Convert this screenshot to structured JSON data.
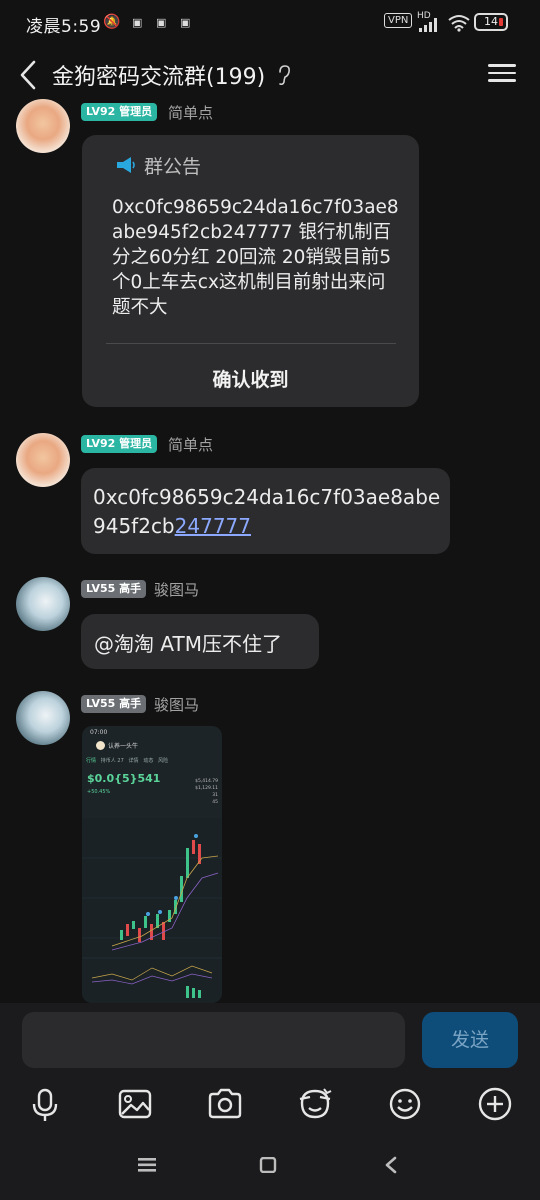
{
  "status_bar": {
    "time": "凌晨5:59",
    "vpn": "VPN",
    "hd": "HD",
    "battery": "14"
  },
  "header": {
    "title": "金狗密码交流群(199)"
  },
  "messages": [
    {
      "badge": "LV92 管理员",
      "nickname": "简单点",
      "notice_title": "群公告",
      "notice_body": "0xc0fc98659c24da16c7f03ae8abe945f2cb247777 银行机制百分之60分红 20回流 20销毁目前5个0上车去cx这机制目前射出来问题不大",
      "confirm_label": "确认收到"
    },
    {
      "badge": "LV92 管理员",
      "nickname": "简单点",
      "text_prefix": "0xc0fc98659c24da16c7f03ae8abe945f2cb",
      "text_link": "247777"
    },
    {
      "badge": "LV55 高手",
      "nickname": "骏图马",
      "text": "@淘淘 ATM压不住了"
    },
    {
      "badge": "LV55 高手",
      "nickname": "骏图马",
      "image": {
        "time": "07:00",
        "title": "认养一头牛",
        "tabs": [
          "行情",
          "持币人 27",
          "详情",
          "动态",
          "风险"
        ],
        "price": "$0.0{5}541",
        "change": "+50.45%",
        "stats": [
          "$5,414.79",
          "$1,129.11",
          "31",
          "45"
        ]
      }
    }
  ],
  "input": {
    "placeholder": "",
    "send_label": "发送"
  },
  "toolbar": [
    "voice-icon",
    "gallery-icon",
    "camera-icon",
    "sticker-icon",
    "emoji-icon",
    "plus-icon"
  ]
}
